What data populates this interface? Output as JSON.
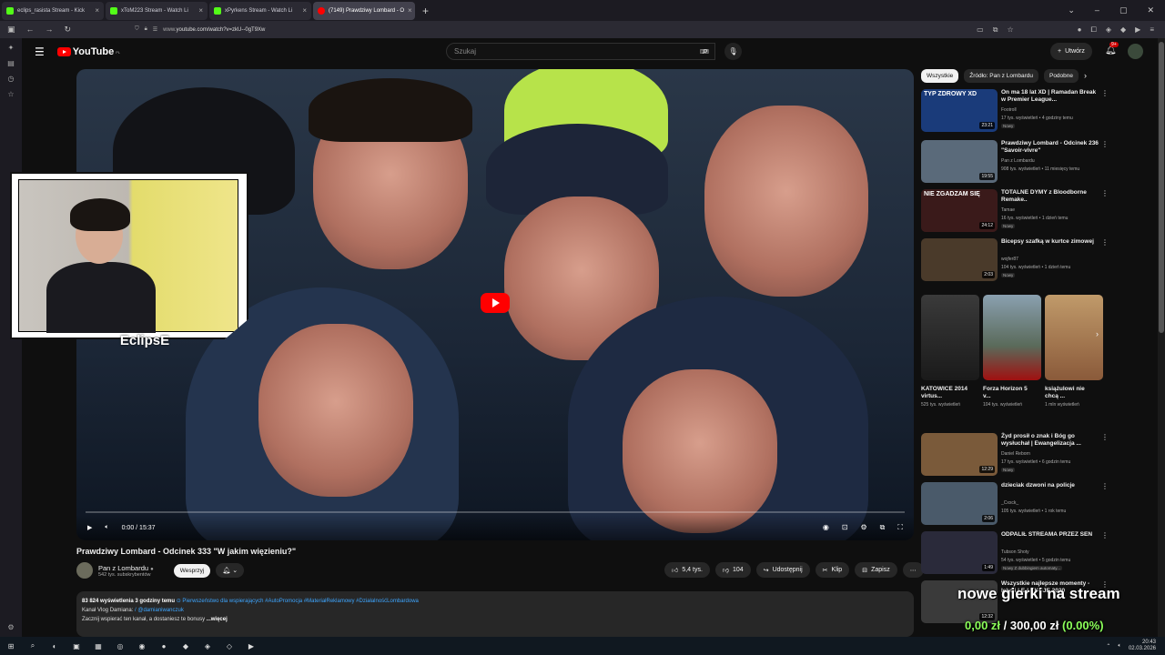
{
  "browser": {
    "tabs": [
      {
        "label": "eclips_rasista Stream - Kick",
        "fav_color": "#53fc18"
      },
      {
        "label": "xToM223 Stream - Watch Li",
        "fav_color": "#53fc18"
      },
      {
        "label": "xPyrkens Stream - Watch Li",
        "fav_color": "#53fc18"
      },
      {
        "label": "(7149) Prawdziwy Lombard - O",
        "fav_color": "#ff0000",
        "active": true
      }
    ],
    "url_prefix": "www.",
    "url": "youtube.com/watch?v=zkU--0gT9Xw"
  },
  "youtube": {
    "logo": "YouTube",
    "logo_region": "PL",
    "search_placeholder": "Szukaj",
    "create_label": "Utwórz",
    "bell_badge": "9+"
  },
  "player": {
    "time": "0:00 / 15:37",
    "streamer_name": "EclipsE"
  },
  "video": {
    "title": "Prawdziwy Lombard - Odcinek 333 \"W jakim więzieniu?\"",
    "channel": "Pan z Lombardu",
    "subscribers": "542 tys. subskrybentów",
    "support_label": "Wesprzyj",
    "likes": "5,4 tys.",
    "dislikes": "104",
    "share_label": "Udostępnij",
    "clip_label": "Klip",
    "save_label": "Zapisz",
    "views": "83 824 wyświetlenia",
    "age": "3 godziny temu",
    "desc_tags": "Pierwszeństwo dla wspierających #AutoPromocja #MateriałReklamowy #DziałalnośćLombardowa",
    "desc_line2_prefix": "Kanał Vlog Damiana: ",
    "desc_line2_link": "/ @damianiwanczuk",
    "desc_line3": "Zacznij wspierać ten kanał, a dostaniesz te bonusy",
    "desc_more": "...więcej"
  },
  "sidebar": {
    "chips": [
      "Wszystkie",
      "Źródło: Pan z Lombardu",
      "Podobne"
    ],
    "recs": [
      {
        "title": "On ma 18 lat XD | Ramadan Break w Premier League...",
        "channel": "Footroll",
        "meta": "17 tys. wyświetleń • 4 godziny temu",
        "duration": "23:21",
        "new": "Nowy",
        "thumb": "#1a3b7a",
        "thumb_text": "TYP ZDROWY XD"
      },
      {
        "title": "Prawdziwy Lombard - Odcinek 236 \"Savoir-vivre\"",
        "channel": "Pan z Lombardu",
        "meta": "908 tys. wyświetleń • 11 miesięcy temu",
        "duration": "19:55",
        "new": "",
        "thumb": "#5a6a7a",
        "thumb_text": ""
      },
      {
        "title": "TOTALNE DYMY z Bloodborne Remake..",
        "channel": "Tamae",
        "meta": "16 tys. wyświetleń • 1 dzień temu",
        "duration": "24:12",
        "new": "Nowy",
        "thumb": "#3a1a1a",
        "thumb_text": "NIE ZGADZAM SIĘ"
      },
      {
        "title": "Bicepsy szafką w kurtce zimowej",
        "channel": "wojfer87",
        "meta": "104 tys. wyświetleń • 1 dzień temu",
        "duration": "2:03",
        "new": "Nowy",
        "thumb": "#4a3a2a",
        "thumb_text": ""
      }
    ],
    "shelf": [
      {
        "title": "KATOWICE 2014 virtus...",
        "meta": "525 tys. wyświetleń",
        "color": "#2a2a2a"
      },
      {
        "title": "Forza Horizon 5 v...",
        "meta": "104 tys. wyświetleń",
        "color": "#5a6a5a"
      },
      {
        "title": "książulowi nie chcą ...",
        "meta": "1 mln wyświetleń",
        "color": "#b08a5a"
      }
    ],
    "recs2": [
      {
        "title": "Żyd prosił o znak i Bóg go wysłuchał | Ewangelizacja ...",
        "channel": "Daniel Reborn",
        "meta": "17 tys. wyświetleń • 6 godzin temu",
        "duration": "12:29",
        "new": "Nowy",
        "thumb": "#7a5a3a"
      },
      {
        "title": "dzieciak dzwoni na policje",
        "channel": "_Cxxck_",
        "meta": "105 tys. wyświetleń • 1 rok temu",
        "duration": "2:06",
        "new": "",
        "thumb": "#4a5a6a"
      },
      {
        "title": "ODPALIŁ STREAMA PRZEZ SEN",
        "channel": "Tubson Shoty",
        "meta": "54 tys. wyświetleń • 5 godzin temu",
        "duration": "1:49",
        "new": "Nowy  Z dubbingiem automaty...",
        "thumb": "#2a2a3a"
      },
      {
        "title": "Wszystkie najlepsze momenty - lekcji | E-LEKCJE 2020",
        "channel": "",
        "meta": "",
        "duration": "12:32",
        "new": "",
        "thumb": "#3a3a3a"
      }
    ]
  },
  "overlay": {
    "line1": "nowe gierki na stream",
    "amount": "0,00 zł",
    "goal": "/ 300,00 zł",
    "percent": "(0.00%)"
  },
  "taskbar": {
    "time": "20:43",
    "date": "02.03.2026"
  }
}
